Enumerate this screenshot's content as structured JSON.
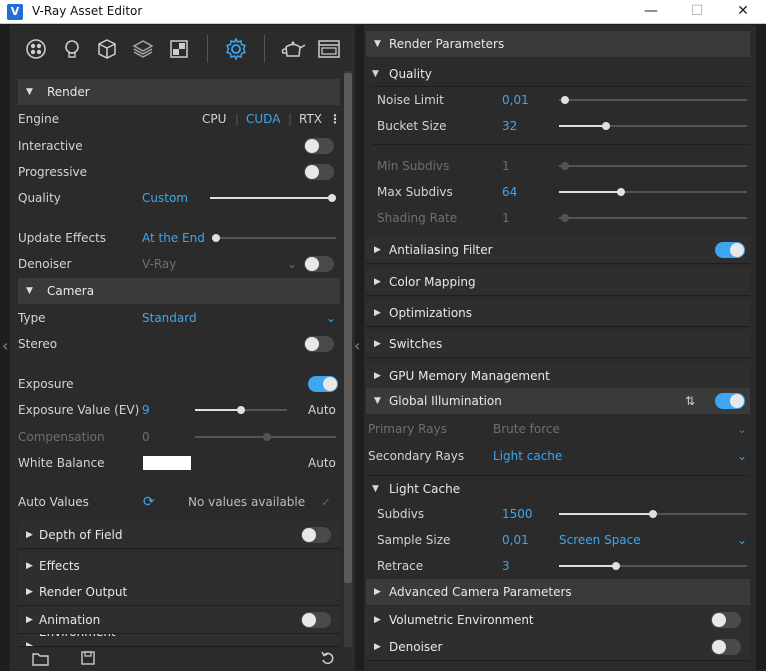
{
  "window": {
    "title": "V-Ray Asset Editor",
    "minimize": "—",
    "maximize": "☐",
    "close": "✕"
  },
  "left": {
    "render_header": "Render",
    "engine": {
      "label": "Engine",
      "options": [
        "CPU",
        "CUDA",
        "RTX"
      ],
      "selected": "CUDA"
    },
    "interactive": {
      "label": "Interactive",
      "on": false
    },
    "progressive": {
      "label": "Progressive",
      "on": false
    },
    "quality": {
      "label": "Quality",
      "value": "Custom",
      "level": 1.0
    },
    "update_effects": {
      "label": "Update Effects",
      "value": "At the End",
      "level": 0.0
    },
    "denoiser": {
      "label": "Denoiser",
      "value": "V-Ray",
      "on": false
    },
    "camera_header": "Camera",
    "type": {
      "label": "Type",
      "value": "Standard"
    },
    "stereo": {
      "label": "Stereo",
      "on": false
    },
    "exposure": {
      "label": "Exposure",
      "on": true
    },
    "exposure_value": {
      "label": "Exposure Value (EV)",
      "value": "9",
      "auto": "Auto",
      "level": 0.5
    },
    "compensation": {
      "label": "Compensation",
      "value": "0",
      "level": 0.5
    },
    "white_balance": {
      "label": "White Balance",
      "auto": "Auto",
      "color": "#ffffff"
    },
    "auto_values": {
      "label": "Auto Values",
      "status": "No values available"
    },
    "sections": [
      {
        "label": "Depth of Field",
        "toggle": false
      },
      {
        "label": "Effects"
      },
      {
        "label": "Render Output"
      },
      {
        "label": "Animation",
        "toggle": false
      },
      {
        "label": "Environment"
      }
    ]
  },
  "right": {
    "render_params_header": "Render Parameters",
    "quality_header": "Quality",
    "noise_limit": {
      "label": "Noise Limit",
      "value": "0,01",
      "level": 0.03
    },
    "bucket_size": {
      "label": "Bucket Size",
      "value": "32",
      "level": 0.25
    },
    "min_subdivs": {
      "label": "Min Subdivs",
      "value": "1",
      "level": 0.03
    },
    "max_subdivs": {
      "label": "Max Subdivs",
      "value": "64",
      "level": 0.33
    },
    "shading_rate": {
      "label": "Shading Rate",
      "value": "1",
      "level": 0.03
    },
    "antialiasing": {
      "label": "Antialiasing Filter",
      "on": true
    },
    "color_mapping": "Color Mapping",
    "optimizations": "Optimizations",
    "switches": "Switches",
    "gpu_memory": "GPU Memory Management",
    "gi": {
      "label": "Global Illumination",
      "on": true
    },
    "primary_rays": {
      "label": "Primary Rays",
      "value": "Brute force"
    },
    "secondary_rays": {
      "label": "Secondary Rays",
      "value": "Light cache"
    },
    "light_cache_header": "Light Cache",
    "lc_subdivs": {
      "label": "Subdivs",
      "value": "1500",
      "level": 0.5
    },
    "lc_sample_size": {
      "label": "Sample Size",
      "value": "0,01",
      "mode": "Screen Space"
    },
    "lc_retrace": {
      "label": "Retrace",
      "value": "3",
      "level": 0.3
    },
    "adv_camera": "Advanced Camera Parameters",
    "volumetric": {
      "label": "Volumetric Environment",
      "on": false
    },
    "denoiser": {
      "label": "Denoiser",
      "on": false
    }
  },
  "colors": {
    "accent": "#3ea6f0",
    "panel": "#2b2b2b",
    "header": "#3a3a3a"
  }
}
